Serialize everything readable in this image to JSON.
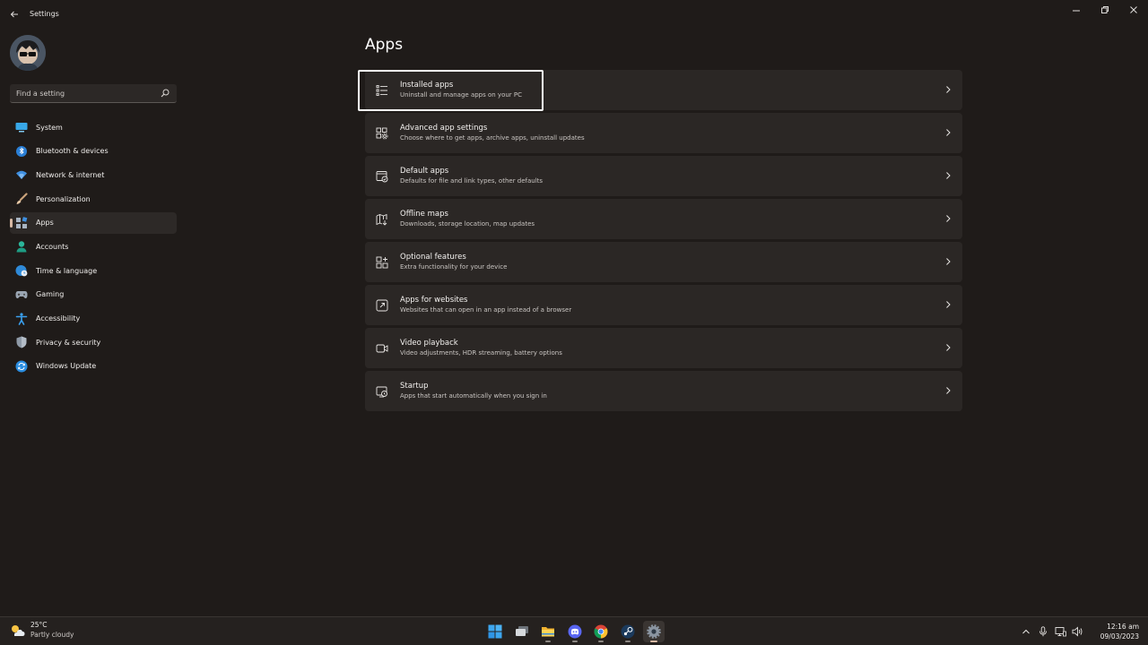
{
  "window": {
    "title": "Settings"
  },
  "search": {
    "placeholder": "Find a setting"
  },
  "sidebar": {
    "items": [
      {
        "label": "System",
        "icon": "system-icon"
      },
      {
        "label": "Bluetooth & devices",
        "icon": "bluetooth-icon"
      },
      {
        "label": "Network & internet",
        "icon": "wifi-icon"
      },
      {
        "label": "Personalization",
        "icon": "brush-icon"
      },
      {
        "label": "Apps",
        "icon": "apps-icon",
        "active": true
      },
      {
        "label": "Accounts",
        "icon": "person-icon"
      },
      {
        "label": "Time & language",
        "icon": "globe-clock-icon"
      },
      {
        "label": "Gaming",
        "icon": "controller-icon"
      },
      {
        "label": "Accessibility",
        "icon": "accessibility-icon"
      },
      {
        "label": "Privacy & security",
        "icon": "shield-icon"
      },
      {
        "label": "Windows Update",
        "icon": "update-icon"
      }
    ]
  },
  "main": {
    "title": "Apps",
    "cards": [
      {
        "title": "Installed apps",
        "subtitle": "Uninstall and manage apps on your PC",
        "icon": "list-icon",
        "highlighted": true
      },
      {
        "title": "Advanced app settings",
        "subtitle": "Choose where to get apps, archive apps, uninstall updates",
        "icon": "app-settings-icon"
      },
      {
        "title": "Default apps",
        "subtitle": "Defaults for file and link types, other defaults",
        "icon": "default-apps-icon"
      },
      {
        "title": "Offline maps",
        "subtitle": "Downloads, storage location, map updates",
        "icon": "map-icon"
      },
      {
        "title": "Optional features",
        "subtitle": "Extra functionality for your device",
        "icon": "add-grid-icon"
      },
      {
        "title": "Apps for websites",
        "subtitle": "Websites that can open in an app instead of a browser",
        "icon": "open-link-icon"
      },
      {
        "title": "Video playback",
        "subtitle": "Video adjustments, HDR streaming, battery options",
        "icon": "video-icon"
      },
      {
        "title": "Startup",
        "subtitle": "Apps that start automatically when you sign in",
        "icon": "startup-icon"
      }
    ]
  },
  "taskbar": {
    "weather": {
      "temp": "25°C",
      "condition": "Partly cloudy"
    },
    "apps": [
      "start-icon",
      "task-view-icon",
      "file-explorer-icon",
      "discord-icon",
      "chrome-icon",
      "steam-icon",
      "settings-icon"
    ],
    "clock": {
      "time": "12:16 am",
      "date": "09/03/2023"
    }
  },
  "colors": {
    "accent": "#d7b9a4",
    "background": "#1f1b19",
    "card": "#2b2725"
  }
}
